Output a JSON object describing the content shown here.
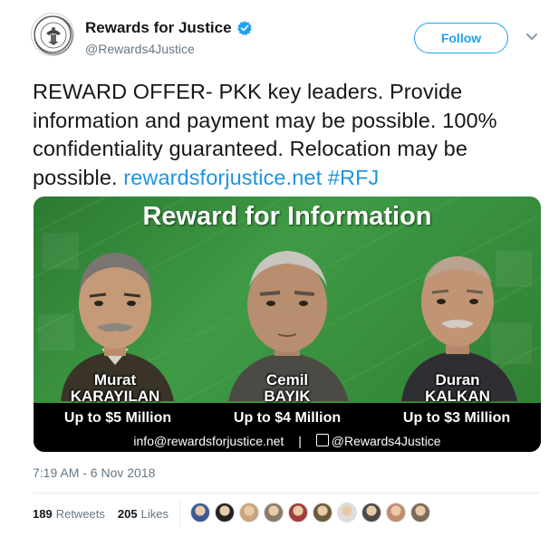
{
  "account": {
    "display_name": "Rewards for Justice",
    "handle": "@Rewards4Justice",
    "verified": true,
    "follow_label": "Follow"
  },
  "tweet": {
    "text_main": "REWARD OFFER- PKK key leaders. Provide information and payment may be possible. 100% confidentiality guaranteed. Relocation may be possible. ",
    "link": "rewardsforjustice.net",
    "hashtag": "#RFJ",
    "timestamp": "7:19 AM - 6 Nov 2018"
  },
  "media": {
    "title": "Reward for Information",
    "people": [
      {
        "first": "Murat",
        "last": "KARAYILAN",
        "amount": "Up to $5 Million"
      },
      {
        "first": "Cemil",
        "last": "BAYIK",
        "amount": "Up to $4 Million"
      },
      {
        "first": "Duran",
        "last": "KALKAN",
        "amount": "Up to $3 Million"
      }
    ],
    "email": "info@rewardsforjustice.net",
    "separator": "|",
    "twitter_handle": "@Rewards4Justice"
  },
  "stats": {
    "retweets_count": "189",
    "retweets_label": "Retweets",
    "likes_count": "205",
    "likes_label": "Likes"
  },
  "colors": {
    "accent": "#1da1f2",
    "link": "#1b95e0",
    "muted": "#657786",
    "media_green": "#2e7d32"
  },
  "likers": [
    {
      "icon": "liker-avatar-1",
      "color": "#3b5998"
    },
    {
      "icon": "liker-avatar-2",
      "color": "#222222"
    },
    {
      "icon": "liker-avatar-3",
      "color": "#caa47a"
    },
    {
      "icon": "liker-avatar-4",
      "color": "#8a7a66"
    },
    {
      "icon": "liker-avatar-5",
      "color": "#a33b3b"
    },
    {
      "icon": "liker-avatar-6",
      "color": "#6b5a3c"
    },
    {
      "icon": "liker-avatar-7",
      "color": "#dedede"
    },
    {
      "icon": "liker-avatar-8",
      "color": "#4a4a4a"
    },
    {
      "icon": "liker-avatar-9",
      "color": "#c28b6e"
    },
    {
      "icon": "liker-avatar-10",
      "color": "#7b6a55"
    }
  ]
}
